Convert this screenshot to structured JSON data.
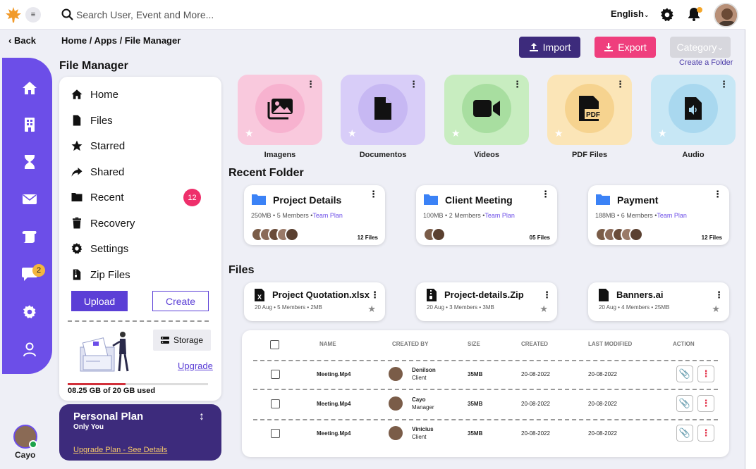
{
  "topbar": {
    "search_placeholder": "Search User, Event and More...",
    "language": "English",
    "notification_dot_color": "#f4a62a"
  },
  "nav": {
    "back": "Back",
    "breadcrumb": "Home / Apps / File Manager"
  },
  "actions": {
    "import": "Import",
    "export": "Export",
    "category": "Category",
    "create_folder": "Create a Folder"
  },
  "sidebar": {
    "icons": [
      "home-icon",
      "building-icon",
      "hourglass-icon",
      "mail-icon",
      "scroll-icon",
      "chat-icon",
      "gear-icon",
      "user-icon"
    ],
    "chat_badge": "2",
    "user_name": "Cayo",
    "accent_color": "#6c4ee8"
  },
  "file_manager": {
    "title": "File Manager",
    "menu": [
      {
        "label": "Home",
        "icon": "home-icon"
      },
      {
        "label": "Files",
        "icon": "file-icon"
      },
      {
        "label": "Starred",
        "icon": "star-icon"
      },
      {
        "label": "Shared",
        "icon": "share-icon"
      },
      {
        "label": "Recent",
        "icon": "folder-icon",
        "count": "12"
      },
      {
        "label": "Recovery",
        "icon": "trash-icon"
      },
      {
        "label": "Settings",
        "icon": "gear-icon"
      },
      {
        "label": "Zip Files",
        "icon": "zip-icon"
      }
    ],
    "upload": "Upload",
    "create": "Create",
    "storage_button": "Storage",
    "upgrade": "Upgrade",
    "storage_used": "08.25 GB of 20 GB used",
    "storage_fraction": 0.41
  },
  "plan": {
    "title": "Personal Plan",
    "subtitle": "Only You",
    "link": "Upgrade Plan - See Details"
  },
  "categories": [
    {
      "label": "Imagens",
      "icon": "images-icon",
      "bg": "#f9c9dd",
      "circle": "#f7b2cf"
    },
    {
      "label": "Documentos",
      "icon": "document-icon",
      "bg": "#d8cdf8",
      "circle": "#c7b8f3"
    },
    {
      "label": "Videos",
      "icon": "video-icon",
      "bg": "#c8edc0",
      "circle": "#a8dea0"
    },
    {
      "label": "PDF Files",
      "icon": "pdf-icon",
      "bg": "#fbe5b7",
      "circle": "#f6d38f"
    },
    {
      "label": "Audio",
      "icon": "audio-icon",
      "bg": "#c7e7f5",
      "circle": "#a9d8ef"
    }
  ],
  "recent_folder": {
    "title": "Recent Folder",
    "items": [
      {
        "name": "Project Details",
        "size": "250MB",
        "members": "5 Members",
        "plan": "Team Plan",
        "files": "12 Files"
      },
      {
        "name": "Client Meeting",
        "size": "100MB",
        "members": "2 Members",
        "plan": "Team Plan",
        "files": "05 Files"
      },
      {
        "name": "Payment",
        "size": "188MB",
        "members": "6 Members",
        "plan": "Team Plan",
        "files": "12 Files"
      }
    ]
  },
  "files": {
    "title": "Files",
    "items": [
      {
        "name": "Project Quotation.xlsx",
        "meta": "20 Aug • 5 Members • 2MB",
        "icon": "excel-file-icon"
      },
      {
        "name": "Project-details.Zip",
        "meta": "20 Aug • 3 Members • 3MB",
        "icon": "zip-file-icon"
      },
      {
        "name": "Banners.ai",
        "meta": "20 Aug • 4 Members • 25MB",
        "icon": "file-icon"
      }
    ]
  },
  "table": {
    "headers": [
      "NAME",
      "CREATED BY",
      "SIZE",
      "CREATED",
      "LAST MODIFIED",
      "ACTION"
    ],
    "rows": [
      {
        "name": "Meeting.Mp4",
        "creator": "Denilson",
        "role": "Client",
        "size": "35MB",
        "created": "20-08-2022",
        "modified": "20-08-2022"
      },
      {
        "name": "Meeting.Mp4",
        "creator": "Cayo",
        "role": "Manager",
        "size": "35MB",
        "created": "20-08-2022",
        "modified": "20-08-2022"
      },
      {
        "name": "Meeting.Mp4",
        "creator": "Vinicius",
        "role": "Client",
        "size": "35MB",
        "created": "20-08-2022",
        "modified": "20-08-2022"
      }
    ]
  }
}
